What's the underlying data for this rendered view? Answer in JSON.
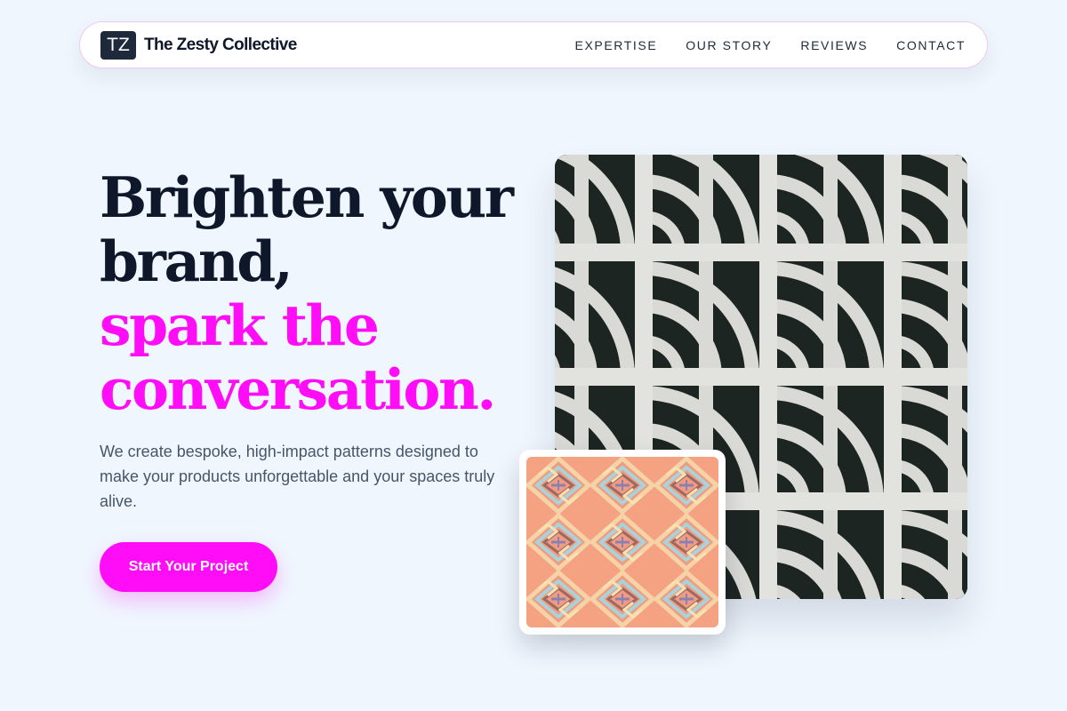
{
  "nav": {
    "logo_initials": "TZ",
    "brand_name": "The Zesty Collective",
    "links": [
      "EXPERTISE",
      "OUR STORY",
      "REVIEWS",
      "CONTACT"
    ]
  },
  "hero": {
    "headline_dark": [
      "Brighten your",
      "brand,"
    ],
    "headline_accent": [
      "spark the",
      "conversation."
    ],
    "description": "We create bespoke, high-impact patterns designed to make your products unforgettable and your spaces truly alive.",
    "cta_label": "Start Your Project"
  },
  "colors": {
    "accent": "#ff0df7",
    "ink": "#0f172a",
    "page_background": "#eff6fe",
    "logo_background": "#1e293b"
  },
  "images": {
    "main": "white concrete breeze-block lattice with circular arc openings",
    "inset": "coral and pastel geometric diamond meander pattern tile"
  }
}
